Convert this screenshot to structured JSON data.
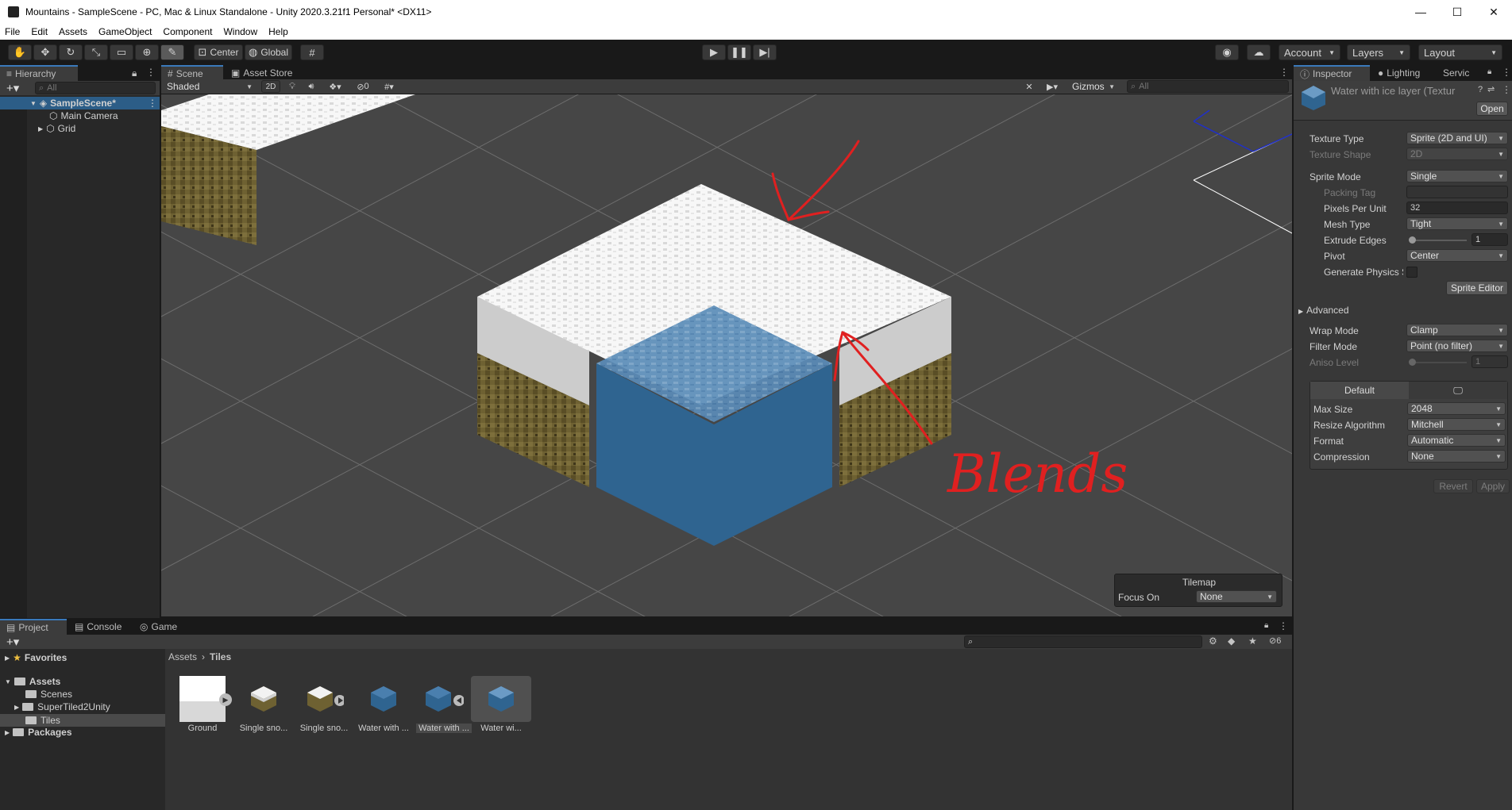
{
  "window": {
    "title": "Mountains - SampleScene - PC, Mac & Linux Standalone - Unity 2020.3.21f1 Personal* <DX11>",
    "minimize": "—",
    "maximize": "☐",
    "close": "✕"
  },
  "menu": [
    "File",
    "Edit",
    "Assets",
    "GameObject",
    "Component",
    "Window",
    "Help"
  ],
  "toolbar": {
    "center_label": "Center",
    "global_label": "Global",
    "account_label": "Account",
    "layers_label": "Layers",
    "layout_label": "Layout"
  },
  "hierarchy": {
    "tab": "Hierarchy",
    "search_placeholder": "All",
    "scene": "SampleScene*",
    "items": [
      "Main Camera",
      "Grid"
    ]
  },
  "scene_view": {
    "tabs": [
      "Scene",
      "Asset Store"
    ],
    "shading": "Shaded",
    "mode_2d": "2D",
    "hidden_count": "0",
    "gizmos": "Gizmos",
    "search_placeholder": "All",
    "annotation": "Blends",
    "tilemap_overlay": {
      "title": "Tilemap",
      "focus_label": "Focus On",
      "focus_value": "None"
    }
  },
  "inspector": {
    "tabs": [
      "Inspector",
      "Lighting",
      "Servic"
    ],
    "asset_name": "Water with ice layer (Textur",
    "open_button": "Open",
    "texture_type": {
      "label": "Texture Type",
      "value": "Sprite (2D and UI)"
    },
    "texture_shape": {
      "label": "Texture Shape",
      "value": "2D"
    },
    "sprite_mode": {
      "label": "Sprite Mode",
      "value": "Single"
    },
    "packing_tag": {
      "label": "Packing Tag",
      "value": ""
    },
    "pixels_per_unit": {
      "label": "Pixels Per Unit",
      "value": "32"
    },
    "mesh_type": {
      "label": "Mesh Type",
      "value": "Tight"
    },
    "extrude_edges": {
      "label": "Extrude Edges",
      "value": "1"
    },
    "pivot": {
      "label": "Pivot",
      "value": "Center"
    },
    "generate_physics": {
      "label": "Generate Physics S"
    },
    "sprite_editor_button": "Sprite Editor",
    "advanced_label": "Advanced",
    "wrap_mode": {
      "label": "Wrap Mode",
      "value": "Clamp"
    },
    "filter_mode": {
      "label": "Filter Mode",
      "value": "Point (no filter)"
    },
    "aniso_level": {
      "label": "Aniso Level",
      "value": "1"
    },
    "platform_tab": "Default",
    "max_size": {
      "label": "Max Size",
      "value": "2048"
    },
    "resize_algorithm": {
      "label": "Resize Algorithm",
      "value": "Mitchell"
    },
    "format": {
      "label": "Format",
      "value": "Automatic"
    },
    "compression": {
      "label": "Compression",
      "value": "None"
    },
    "revert_button": "Revert",
    "apply_button": "Apply"
  },
  "project": {
    "tabs": [
      "Project",
      "Console",
      "Game"
    ],
    "hidden_count": "6",
    "favorites": "Favorites",
    "assets": "Assets",
    "folders": [
      "Scenes",
      "SuperTiled2Unity",
      "Tiles"
    ],
    "packages": "Packages",
    "breadcrumb": [
      "Assets",
      "Tiles"
    ],
    "tiles": [
      "Ground",
      "Single sno...",
      "Single sno...",
      "Water with ...",
      "Water with ...",
      "Water wi..."
    ]
  },
  "colors": {
    "accent": "#3a79bb",
    "scene_bg": "#464646",
    "water": "#2f6490",
    "annotation": "#e02020"
  }
}
